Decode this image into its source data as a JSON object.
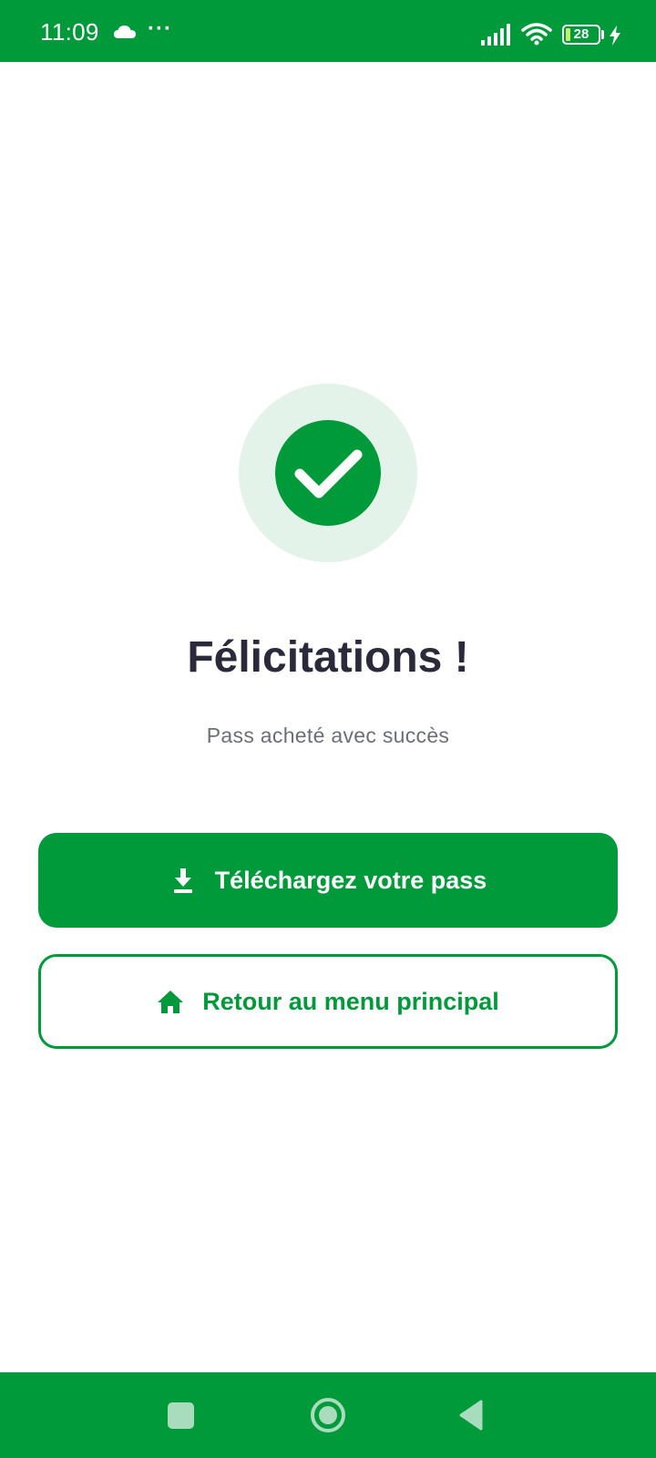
{
  "status_bar": {
    "time": "11:09",
    "more": "···",
    "battery_level": "28",
    "icons": [
      "cloud-icon",
      "signal-icon",
      "wifi-icon",
      "battery-icon",
      "charging-icon"
    ]
  },
  "success": {
    "icon": "checkmark-icon",
    "title": "Félicitations !",
    "subtitle": "Pass acheté avec succès"
  },
  "actions": {
    "download": {
      "label": "Téléchargez votre pass",
      "icon": "download-icon"
    },
    "home": {
      "label": "Retour au menu principal",
      "icon": "home-icon"
    }
  },
  "nav_bar": {
    "buttons": [
      "recents-icon",
      "home-circle-icon",
      "back-icon"
    ]
  },
  "colors": {
    "primary": "#009a3a",
    "success_halo": "#e4f3ea",
    "title": "#2b2a3a",
    "subtitle": "#6c6f75",
    "background": "#ffffff"
  }
}
